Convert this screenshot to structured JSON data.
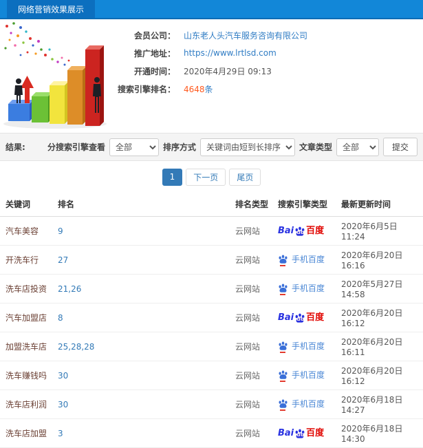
{
  "header": {
    "title": "网络营销效果展示"
  },
  "info": {
    "member_label": "会员公司：",
    "member_value": "山东老人头汽车服务咨询有限公司",
    "url_label": "推广地址：",
    "url_value": "https://www.lrtlsd.com",
    "open_label": "开通时间：",
    "open_value": "2020年4月29日 09:13",
    "rankcount_label": "搜索引擎排名：",
    "rankcount_value": "4648",
    "rankcount_suffix": "条"
  },
  "filters": {
    "result_label": "结果:",
    "engine_label": "分搜索引擎查看",
    "engine_value": "全部",
    "sort_label": "排序方式",
    "sort_value": "关键词由短到长排序",
    "article_label": "文章类型",
    "article_value": "全部",
    "submit_label": "提交"
  },
  "pagination": {
    "current": "1",
    "next_label": "下一页",
    "last_label": "尾页"
  },
  "table": {
    "headers": [
      "关键词",
      "排名",
      "排名类型",
      "搜索引擎类型",
      "最新更新时间"
    ],
    "engine_labels": {
      "baidu": {
        "bai": "Bai",
        "du": "du",
        "cn": "百度"
      },
      "mobile_baidu": {
        "text": "手机百度"
      }
    },
    "rows": [
      {
        "keyword": "汽车美容",
        "rank": "9",
        "rank_type": "云网站",
        "engine": "baidu",
        "updated": "2020年6月5日 11:24"
      },
      {
        "keyword": "开洗车行",
        "rank": "27",
        "rank_type": "云网站",
        "engine": "mobile_baidu",
        "updated": "2020年6月20日 16:16"
      },
      {
        "keyword": "洗车店投资",
        "rank": "21,26",
        "rank_type": "云网站",
        "engine": "mobile_baidu",
        "updated": "2020年5月27日 14:58"
      },
      {
        "keyword": "汽车加盟店",
        "rank": "8",
        "rank_type": "云网站",
        "engine": "baidu",
        "updated": "2020年6月20日 16:12"
      },
      {
        "keyword": "加盟洗车店",
        "rank": "25,28,28",
        "rank_type": "云网站",
        "engine": "mobile_baidu",
        "updated": "2020年6月20日 16:11"
      },
      {
        "keyword": "洗车赚钱吗",
        "rank": "30",
        "rank_type": "云网站",
        "engine": "mobile_baidu",
        "updated": "2020年6月20日 16:12"
      },
      {
        "keyword": "洗车店利润",
        "rank": "30",
        "rank_type": "云网站",
        "engine": "mobile_baidu",
        "updated": "2020年6月18日 14:27"
      },
      {
        "keyword": "洗车店加盟",
        "rank": "3",
        "rank_type": "云网站",
        "engine": "baidu",
        "updated": "2020年6月18日 14:30"
      }
    ]
  },
  "colors": {
    "header_bar": "#1287d8",
    "header_title_bg": "#0c6fbf",
    "link_blue": "#2f7cc4",
    "highlight_orange": "#ff5a1f",
    "pagination_active": "#337ab7",
    "baidu_blue": "#2932e1",
    "baidu_red": "#e10602",
    "mobile_baidu_blue": "#4a87d5",
    "keyword_text": "#6b4034"
  }
}
